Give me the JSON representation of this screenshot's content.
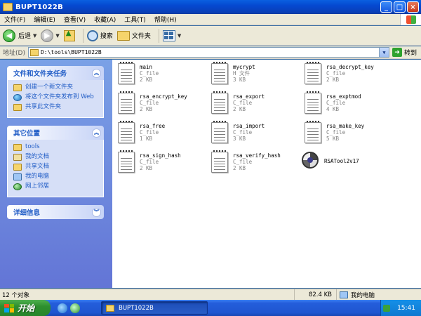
{
  "window": {
    "title": "BUPT1022B"
  },
  "menu": [
    "文件(F)",
    "编辑(E)",
    "查看(V)",
    "收藏(A)",
    "工具(T)",
    "帮助(H)"
  ],
  "toolbar": {
    "back_label": "后退",
    "search_label": "搜索",
    "folders_label": "文件夹"
  },
  "address": {
    "label": "地址(D)",
    "value": "D:\\tools\\BUPT1022B",
    "go_label": "转到"
  },
  "left_pane": {
    "tasks": {
      "title": "文件和文件夹任务",
      "items": [
        "创建一个新文件夹",
        "将这个文件夹发布到 Web",
        "共享此文件夹"
      ]
    },
    "other": {
      "title": "其它位置",
      "items": [
        "tools",
        "我的文档",
        "共享文档",
        "我的电脑",
        "网上邻居"
      ]
    },
    "details": {
      "title": "详细信息"
    }
  },
  "files": [
    {
      "name": "main",
      "type": "C_file",
      "size": "2 KB"
    },
    {
      "name": "mycrypt",
      "type": "H 文件",
      "size": "3 KB"
    },
    {
      "name": "rsa_decrypt_key",
      "type": "C_file",
      "size": "2 KB"
    },
    {
      "name": "rsa_encrypt_key",
      "type": "C_file",
      "size": "2 KB"
    },
    {
      "name": "rsa_export",
      "type": "C_file",
      "size": "2 KB"
    },
    {
      "name": "rsa_exptmod",
      "type": "C_file",
      "size": "4 KB"
    },
    {
      "name": "rsa_free",
      "type": "C_file",
      "size": "1 KB"
    },
    {
      "name": "rsa_import",
      "type": "C_file",
      "size": "3 KB"
    },
    {
      "name": "rsa_make_key",
      "type": "C_file",
      "size": "5 KB"
    },
    {
      "name": "rsa_sign_hash",
      "type": "C_file",
      "size": "2 KB"
    },
    {
      "name": "rsa_verify_hash",
      "type": "C_file",
      "size": "2 KB"
    },
    {
      "name": "RSATool2v17",
      "type": "",
      "size": ""
    }
  ],
  "status": {
    "count": "12 个对象",
    "size": "82.4 KB",
    "location": "我的电脑"
  },
  "taskbar": {
    "start_label": "开始",
    "task_label": "BUPT1022B",
    "clock": "15:41"
  }
}
